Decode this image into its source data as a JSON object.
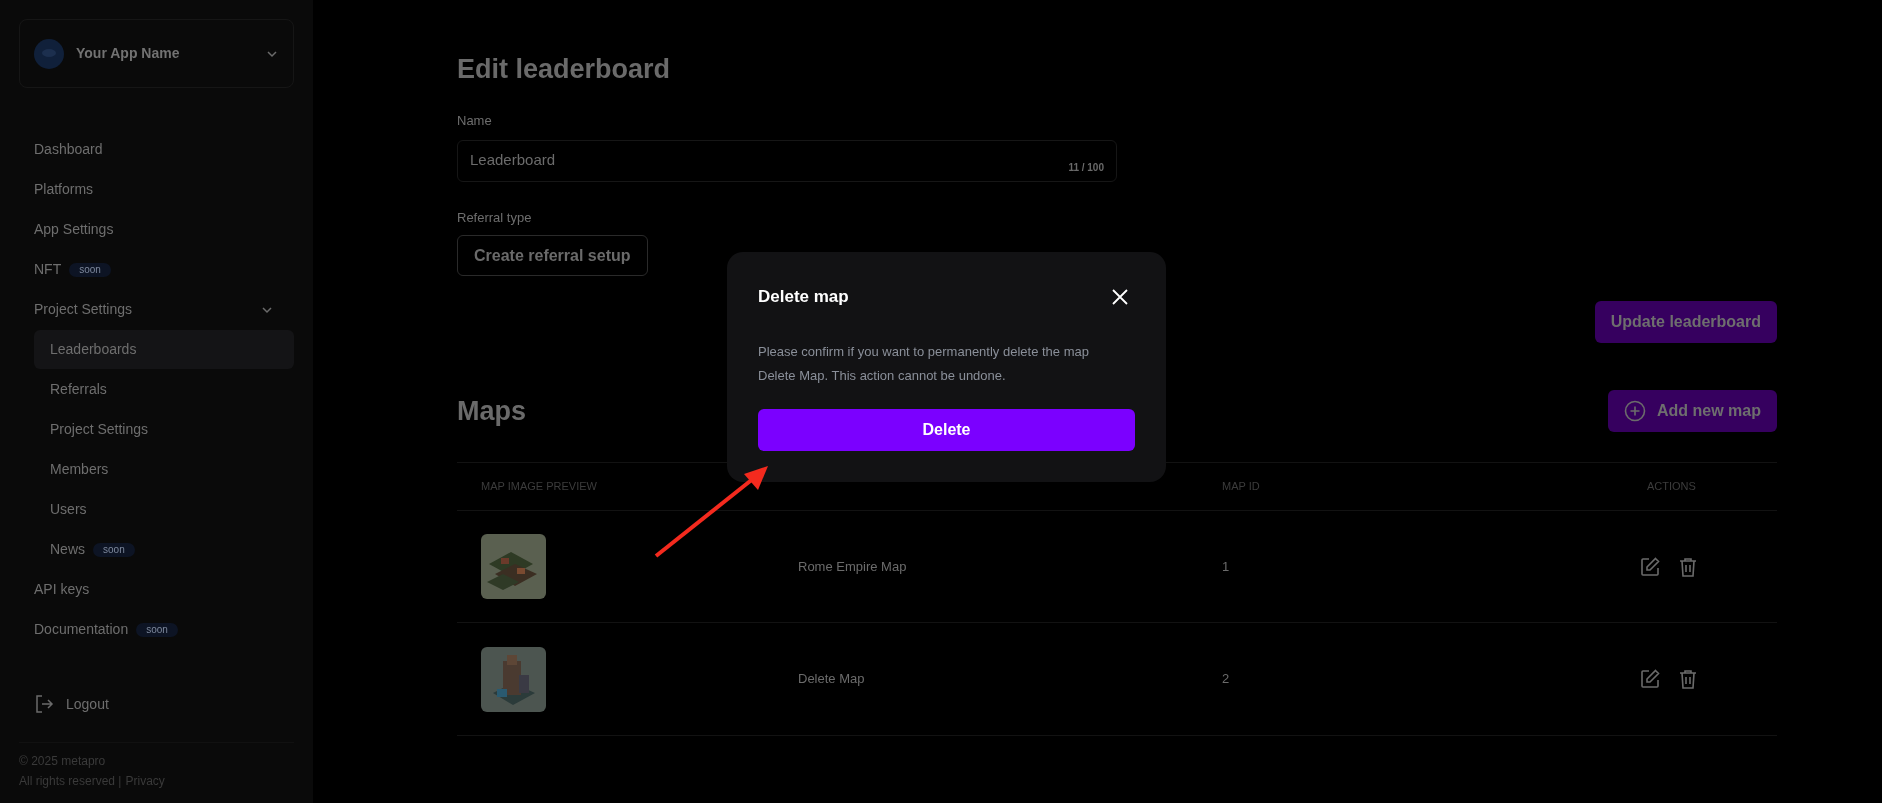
{
  "app": {
    "name": "Your App Name"
  },
  "sidebar": {
    "items": [
      {
        "label": "Dashboard",
        "selected": false
      },
      {
        "label": "Platforms",
        "selected": false
      },
      {
        "label": "App Settings",
        "selected": false
      },
      {
        "label": "NFT",
        "badge": "soon",
        "selected": false
      },
      {
        "label": "Project Settings",
        "selected": false,
        "expanded": true,
        "children": [
          {
            "label": "Leaderboards",
            "selected": true
          },
          {
            "label": "Referrals",
            "selected": false
          },
          {
            "label": "Project Settings",
            "selected": false
          },
          {
            "label": "Members",
            "selected": false
          },
          {
            "label": "Users",
            "selected": false
          },
          {
            "label": "News",
            "badge": "soon",
            "selected": false
          }
        ]
      },
      {
        "label": "API keys",
        "selected": false
      },
      {
        "label": "Documentation",
        "badge": "soon",
        "selected": false
      }
    ]
  },
  "logout": "Logout",
  "footer": {
    "copyright": "© 2025 metapro",
    "rights": "All rights reserved |",
    "privacy": "Privacy"
  },
  "page_title": "Edit leaderboard",
  "form": {
    "name_label": "Name",
    "name_value": "Leaderboard",
    "name_counter": "11 / 100",
    "referral_label": "Referral type",
    "referral_button": "Create referral setup",
    "submit": "Update leaderboard"
  },
  "maps": {
    "title": "Maps",
    "add_button": "Add new map",
    "columns": [
      "MAP IMAGE PREVIEW",
      "MAP ID",
      "ACTIONS"
    ],
    "rows": [
      {
        "name": "Rome Empire Map",
        "id": "1",
        "kind": "picture"
      },
      {
        "name": "Delete Map",
        "id": "2",
        "kind": "picture"
      }
    ]
  },
  "modal": {
    "title": "Delete map",
    "message": "Please confirm if you want to permanently delete the map Delete Map. This action cannot be undone.",
    "confirm": "Delete"
  }
}
